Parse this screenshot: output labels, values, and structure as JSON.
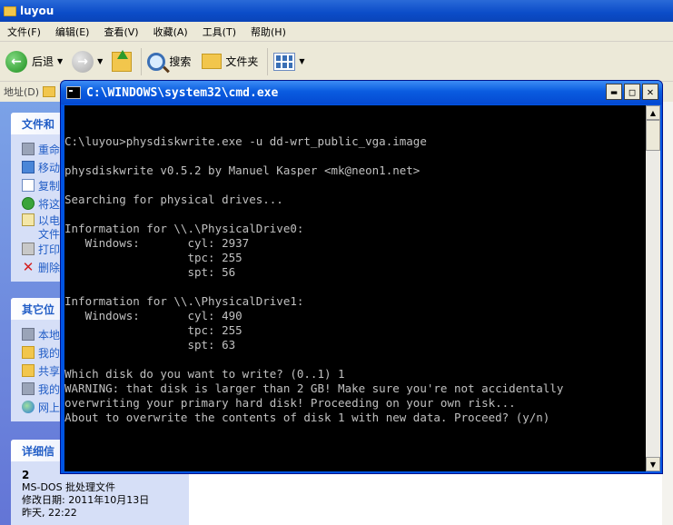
{
  "explorer": {
    "title": "luyou",
    "menu": [
      "文件(F)",
      "编辑(E)",
      "查看(V)",
      "收藏(A)",
      "工具(T)",
      "帮助(H)"
    ],
    "toolbar": {
      "back_label": "后退",
      "search_label": "搜索",
      "folders_label": "文件夹"
    },
    "address_label": "地址(D)",
    "taskpane": {
      "file_tasks": {
        "header": "文件和",
        "items": [
          {
            "label": "重命",
            "icon": "rename-icon"
          },
          {
            "label": "移动",
            "icon": "move-icon"
          },
          {
            "label": "复制",
            "icon": "copy-icon"
          },
          {
            "label": "将这",
            "icon": "publish-icon"
          },
          {
            "label": "以电",
            "icon": "email-icon"
          },
          {
            "label": "文件",
            "icon": ""
          },
          {
            "label": "打印",
            "icon": "print-icon"
          },
          {
            "label": "删除",
            "icon": "delete-icon"
          }
        ]
      },
      "other_places": {
        "header": "其它位",
        "items": [
          {
            "label": "本地",
            "icon": "drive-icon"
          },
          {
            "label": "我的",
            "icon": "folder-icon"
          },
          {
            "label": "共享",
            "icon": "shared-folder-icon"
          },
          {
            "label": "我的",
            "icon": "computer-icon"
          },
          {
            "label": "网上",
            "icon": "network-icon"
          }
        ]
      },
      "details": {
        "header": "详细信",
        "name": "2",
        "type": "MS-DOS 批处理文件",
        "modified": "修改日期: 2011年10月13日",
        "time": "昨天, 22:22"
      }
    }
  },
  "cmd": {
    "title": "C:\\WINDOWS\\system32\\cmd.exe",
    "lines": [
      "",
      "C:\\luyou>physdiskwrite.exe -u dd-wrt_public_vga.image",
      "",
      "physdiskwrite v0.5.2 by Manuel Kasper <mk@neon1.net>",
      "",
      "Searching for physical drives...",
      "",
      "Information for \\\\.\\PhysicalDrive0:",
      "   Windows:       cyl: 2937",
      "                  tpc: 255",
      "                  spt: 56",
      "",
      "Information for \\\\.\\PhysicalDrive1:",
      "   Windows:       cyl: 490",
      "                  tpc: 255",
      "                  spt: 63",
      "",
      "Which disk do you want to write? (0..1) 1",
      "WARNING: that disk is larger than 2 GB! Make sure you're not accidentally",
      "overwriting your primary hard disk! Proceeding on your own risk...",
      "About to overwrite the contents of disk 1 with new data. Proceed? (y/n)"
    ]
  }
}
